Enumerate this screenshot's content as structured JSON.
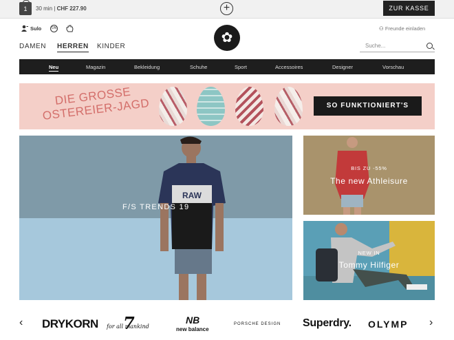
{
  "topbar": {
    "cart_time": "30 min",
    "cart_sep": "|",
    "cart_total": "CHF 227.90",
    "bag_count": "1",
    "plus_symbol": "+",
    "checkout_label": "ZUR KASSE"
  },
  "utility": {
    "account_label": "Sulo",
    "chat_label": "ON",
    "friends_label": "Freunde einladen"
  },
  "logo": {
    "glyph": "✿"
  },
  "gender_nav": [
    "DAMEN",
    "HERREN",
    "KINDER"
  ],
  "search": {
    "placeholder": "Suche..."
  },
  "category_nav": [
    "Neu",
    "Magazin",
    "Bekleidung",
    "Schuhe",
    "Sport",
    "Accessoires",
    "Designer",
    "Vorschau"
  ],
  "easter_banner": {
    "line1": "DIE GROSSE",
    "line2": "OSTEREIER-JAGD",
    "cta": "SO FUNKTIONIERT'S"
  },
  "hero": {
    "label": "F/S TRENDS 19",
    "shirt_text": "RAW"
  },
  "tile_athleisure": {
    "subtitle": "BIS ZU -55%",
    "title": "The new Athleisure"
  },
  "tile_tommy": {
    "subtitle": "NEW IN",
    "title": "Tommy Hilfiger"
  },
  "brands": {
    "prev": "‹",
    "next": "›",
    "items": [
      "DRYKORN",
      "for all mankind",
      "new balance",
      "PORSCHE DESIGN",
      "Superdry.",
      "OLYMP"
    ],
    "seven": "7",
    "nb_mark": "NB"
  }
}
